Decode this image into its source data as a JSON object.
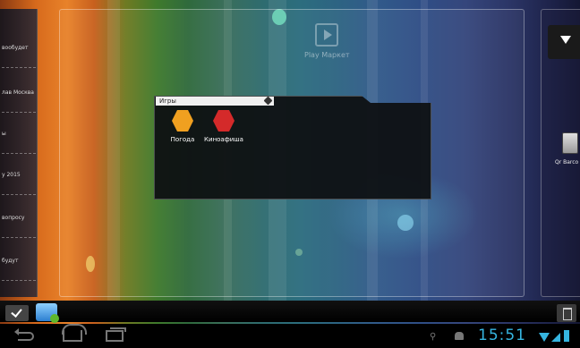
{
  "workspace": {
    "play_market_label": "Play Маркет"
  },
  "left_widget": {
    "items": [
      "вообудет",
      "лав Москва",
      "ы",
      "у 2015",
      "вопросу",
      "будут"
    ]
  },
  "right_panel": {
    "app_label": "Qr Barco"
  },
  "folder": {
    "title": "Игры",
    "apps": [
      {
        "label": "Погода",
        "icon": "umbrella-icon",
        "color": "#f0a020"
      },
      {
        "label": "Киноафиша",
        "icon": "ticket-icon",
        "color": "#d42a2a"
      }
    ]
  },
  "status_bar": {
    "time": "15:51"
  },
  "colors": {
    "accent": "#36b5e0"
  }
}
